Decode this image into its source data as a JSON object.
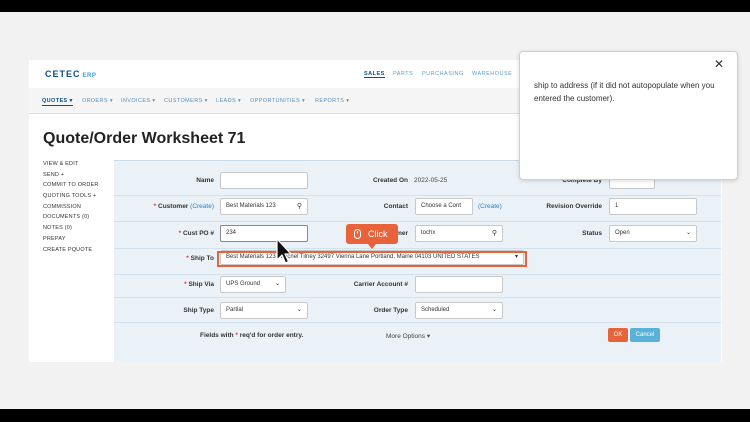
{
  "app": {
    "logo": "CETEC",
    "logo_suffix": "ERP",
    "top_nav": [
      "SALES",
      "PARTS",
      "PURCHASING",
      "WAREHOUSE"
    ],
    "menu": [
      "QUOTES ▾",
      "ORDERS ▾",
      "INVOICES ▾",
      "CUSTOMERS ▾",
      "LEADS ▾",
      "OPPORTUNITIES ▾",
      "REPORTS ▾"
    ]
  },
  "page": {
    "title": "Quote/Order Worksheet 71"
  },
  "sidebar": [
    "VIEW & EDIT",
    "SEND +",
    "COMMIT TO ORDER",
    "QUOTING TOOLS +",
    "COMMISSION",
    "DOCUMENTS (0)",
    "NOTES (0)",
    "PREPAY",
    "CREATE PQUOTE"
  ],
  "form": {
    "name_label": "Name",
    "name_value": "",
    "created_on_label": "Created On",
    "created_on_value": "2022-05-25",
    "complete_by_label": "Complete By",
    "customer_label": "Customer",
    "customer_create": "(Create)",
    "customer_value": "Best Materials 123",
    "contact_label": "Contact",
    "contact_value": "Choose a Cont",
    "contact_create": "(Create)",
    "revision_label": "Revision Override",
    "revision_value": "1",
    "cust_po_label": "Cust PO #",
    "cust_po_value": "234",
    "partner_label": "mer",
    "partner_value": "tochx",
    "status_label": "Status",
    "status_value": "Open",
    "ship_to_label": "Ship To",
    "ship_to_value": "Best Materials 123 - Michel Tilney 32497 Vienna Lane Portland, Maine 04103 UNITED STATES",
    "ship_via_label": "Ship Via",
    "ship_via_value": "UPS Ground",
    "carrier_label": "Carrier Account #",
    "carrier_value": "",
    "ship_type_label": "Ship Type",
    "ship_type_value": "Partial",
    "order_type_label": "Order Type",
    "order_type_value": "Scheduled",
    "footnote_pre": "Fields with",
    "footnote_post": "req'd for order entry.",
    "more_options": "More Options ▾",
    "ok": "OK",
    "cancel": "Cancel"
  },
  "tooltip": {
    "text": "ship to address (if it did not autopopulate when you entered the customer).",
    "close": "✕"
  },
  "overlay": {
    "click_label": "Click"
  },
  "colors": {
    "brand": "#0b4f8a",
    "accent": "#e8633a",
    "ok": "#e8633a",
    "cancel": "#5bb2d8",
    "link": "#2a7fc1"
  }
}
